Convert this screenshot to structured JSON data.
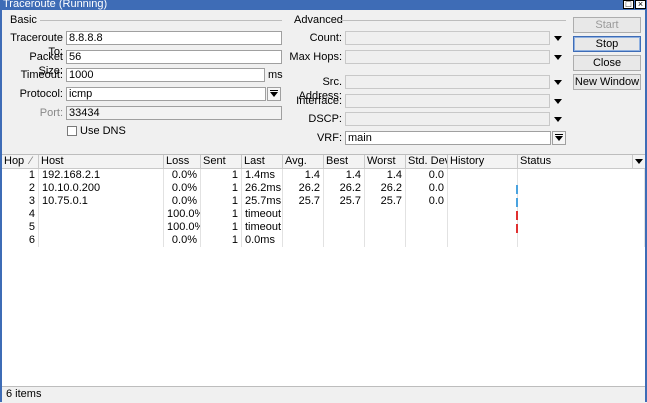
{
  "window": {
    "title": "Traceroute (Running)"
  },
  "basic": {
    "group_label": "Basic",
    "traceroute_to_label": "Traceroute To:",
    "traceroute_to_value": "8.8.8.8",
    "packet_size_label": "Packet Size:",
    "packet_size_value": "56",
    "timeout_label": "Timeout:",
    "timeout_value": "1000",
    "timeout_unit": "ms",
    "protocol_label": "Protocol:",
    "protocol_value": "icmp",
    "port_label": "Port:",
    "port_value": "33434",
    "use_dns_label": "Use DNS",
    "use_dns_checked": false
  },
  "advanced": {
    "group_label": "Advanced",
    "count_label": "Count:",
    "max_hops_label": "Max Hops:",
    "src_address_label": "Src. Address:",
    "interface_label": "Interface:",
    "dscp_label": "DSCP:",
    "vrf_label": "VRF:",
    "vrf_value": "main"
  },
  "buttons": {
    "start": "Start",
    "stop": "Stop",
    "close": "Close",
    "new_window": "New Window"
  },
  "table": {
    "columns": [
      "Hop",
      "Host",
      "Loss",
      "Sent",
      "Last",
      "Avg.",
      "Best",
      "Worst",
      "Std. Dev.",
      "History",
      "Status"
    ],
    "rows": [
      {
        "hop": "1",
        "host": "192.168.2.1",
        "loss": "0.0%",
        "sent": "1",
        "last": "1.4ms",
        "avg": "1.4",
        "best": "1.4",
        "worst": "1.4",
        "std": "0.0",
        "history": ""
      },
      {
        "hop": "2",
        "host": "10.10.0.200",
        "loss": "0.0%",
        "sent": "1",
        "last": "26.2ms",
        "avg": "26.2",
        "best": "26.2",
        "worst": "26.2",
        "std": "0.0",
        "history": "ok"
      },
      {
        "hop": "3",
        "host": "10.75.0.1",
        "loss": "0.0%",
        "sent": "1",
        "last": "25.7ms",
        "avg": "25.7",
        "best": "25.7",
        "worst": "25.7",
        "std": "0.0",
        "history": "ok"
      },
      {
        "hop": "4",
        "host": "",
        "loss": "100.0%",
        "sent": "1",
        "last": "timeout",
        "avg": "",
        "best": "",
        "worst": "",
        "std": "",
        "history": "timeout"
      },
      {
        "hop": "5",
        "host": "",
        "loss": "100.0%",
        "sent": "1",
        "last": "timeout",
        "avg": "",
        "best": "",
        "worst": "",
        "std": "",
        "history": "timeout"
      },
      {
        "hop": "6",
        "host": "",
        "loss": "0.0%",
        "sent": "1",
        "last": "0.0ms",
        "avg": "",
        "best": "",
        "worst": "",
        "std": "",
        "history": ""
      }
    ]
  },
  "status": {
    "items_text": "6 items"
  },
  "colors": {
    "accent": "#3e6cb6",
    "history_ok": "#4aa3df",
    "history_timeout": "#e03030"
  }
}
